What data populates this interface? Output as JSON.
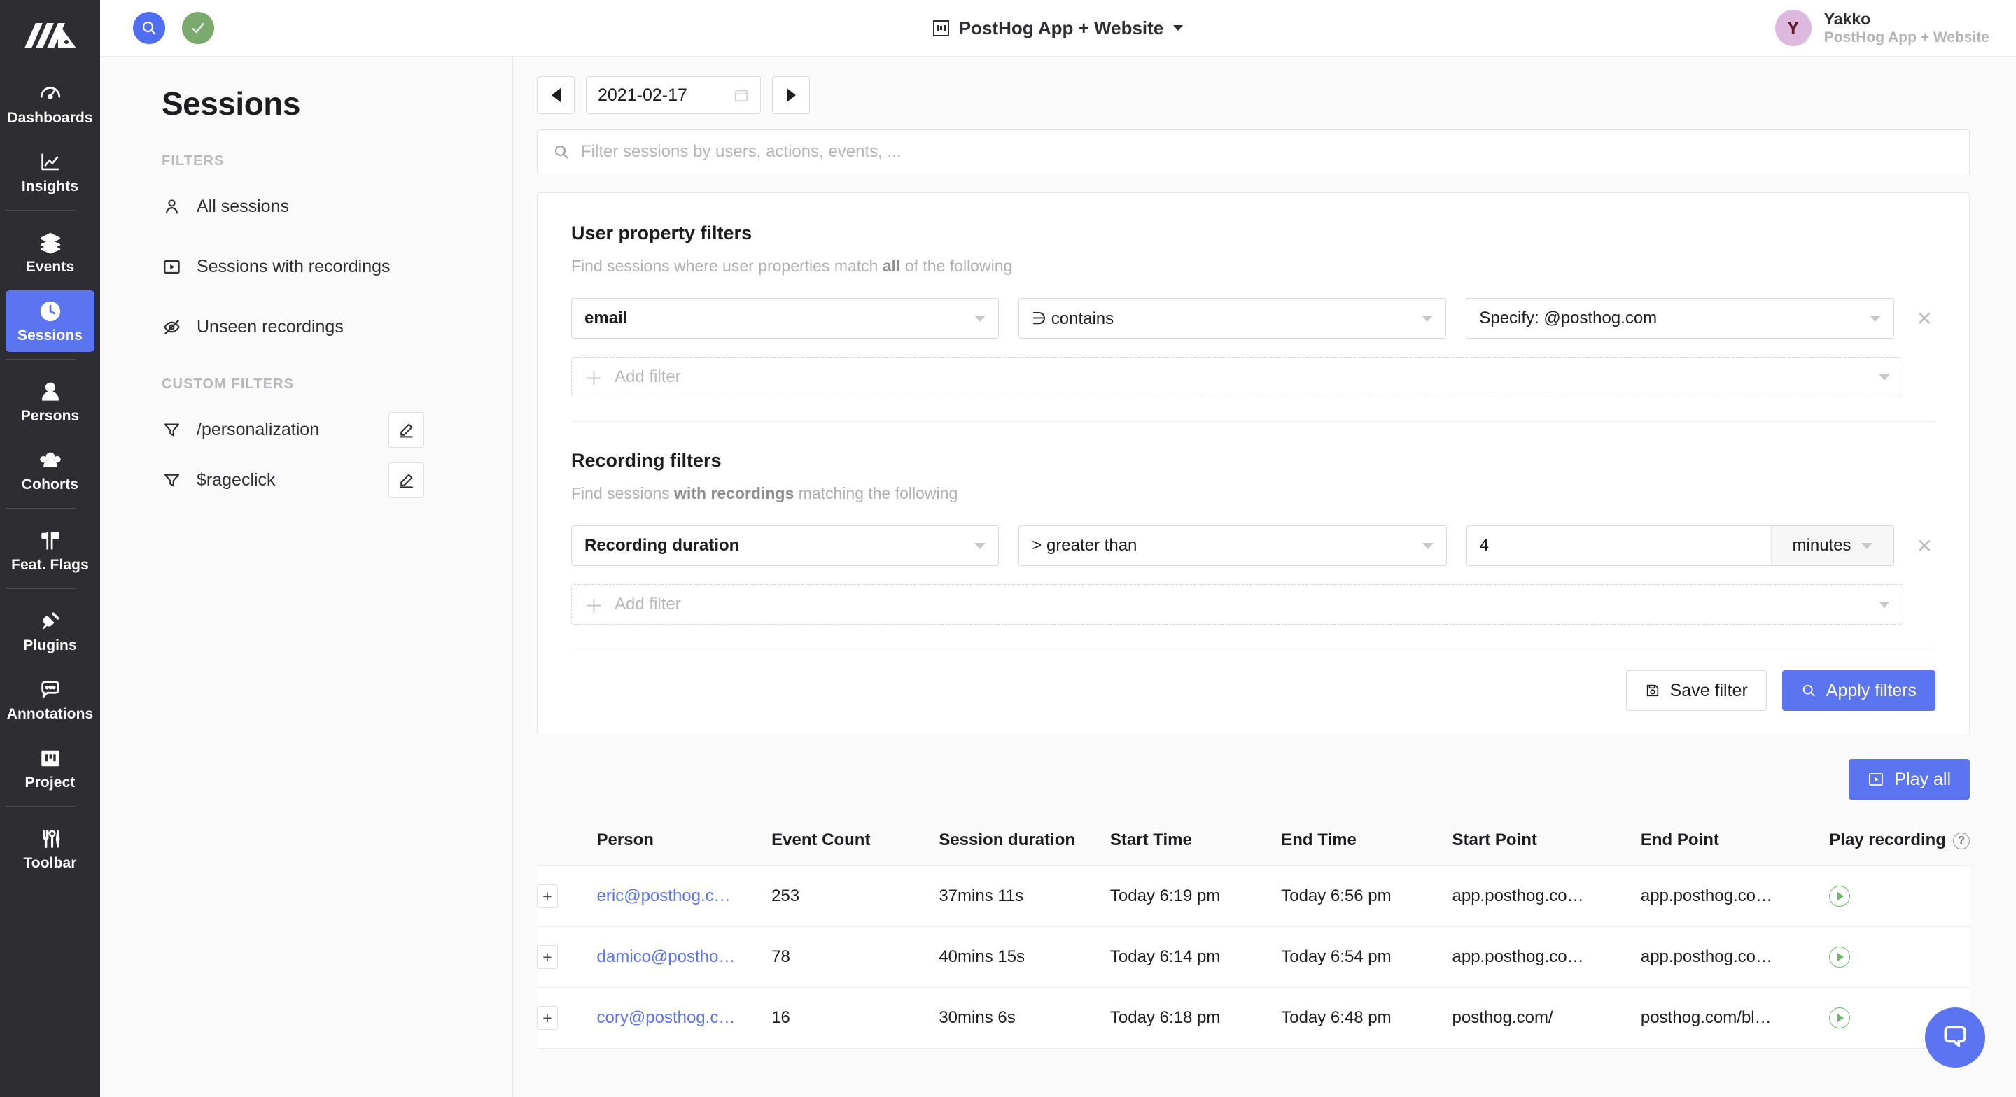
{
  "colors": {
    "accent": "#5b75f0",
    "nav_bg": "#2d2d32",
    "green": "#6cb86c",
    "avatar_bg": "#ddb9e0"
  },
  "topbar": {
    "search_icon": "search-icon",
    "check_icon": "check-icon",
    "project_icon": "project-icon",
    "title": "PostHog App + Website",
    "chevron_icon": "chevron-down-icon",
    "user": {
      "initial": "Y",
      "name": "Yakko",
      "org": "PostHog App + Website"
    }
  },
  "sidebar": {
    "logo": "posthog-logo",
    "items": [
      {
        "label": "Dashboards",
        "icon": "dashboards-icon",
        "active": false,
        "sep_after": false
      },
      {
        "label": "Insights",
        "icon": "insights-icon",
        "active": false,
        "sep_after": true
      },
      {
        "label": "Events",
        "icon": "events-icon",
        "active": false,
        "sep_after": false
      },
      {
        "label": "Sessions",
        "icon": "clock-icon",
        "active": true,
        "sep_after": true
      },
      {
        "label": "Persons",
        "icon": "person-icon",
        "active": false,
        "sep_after": false
      },
      {
        "label": "Cohorts",
        "icon": "cohorts-icon",
        "active": false,
        "sep_after": true
      },
      {
        "label": "Feat. Flags",
        "icon": "flag-icon",
        "active": false,
        "sep_after": true
      },
      {
        "label": "Plugins",
        "icon": "plug-icon",
        "active": false,
        "sep_after": false
      },
      {
        "label": "Annotations",
        "icon": "comment-dots-icon",
        "active": false,
        "sep_after": false
      },
      {
        "label": "Project",
        "icon": "project-icon",
        "active": false,
        "sep_after": true
      },
      {
        "label": "Toolbar",
        "icon": "toolbar-icon",
        "active": false,
        "sep_after": false
      }
    ]
  },
  "leftpanel": {
    "page_title": "Sessions",
    "filters_label": "FILTERS",
    "filters": [
      {
        "label": "All sessions",
        "icon": "person-outline-icon"
      },
      {
        "label": "Sessions with recordings",
        "icon": "play-box-icon"
      },
      {
        "label": "Unseen recordings",
        "icon": "eye-off-icon"
      }
    ],
    "custom_label": "CUSTOM FILTERS",
    "custom_filters": [
      {
        "label": "/personalization",
        "icon": "funnel-icon",
        "edit_icon": "pencil-icon"
      },
      {
        "label": "$rageclick",
        "icon": "funnel-icon",
        "edit_icon": "pencil-icon"
      }
    ]
  },
  "main": {
    "date": {
      "prev_icon": "arrow-left-icon",
      "value": "2021-02-17",
      "calendar_icon": "calendar-icon",
      "next_icon": "arrow-right-icon"
    },
    "search": {
      "icon": "search-icon",
      "placeholder": "Filter sessions by users, actions, events, ..."
    },
    "user_property_filters": {
      "title": "User property filters",
      "desc_pre": "Find sessions where user properties match ",
      "desc_bold": "all",
      "desc_post": " of the following",
      "rows": [
        {
          "property": "email",
          "operator": "∋ contains",
          "value": "Specify: @posthog.com",
          "remove_icon": "close-icon"
        }
      ],
      "add_filter": "Add filter"
    },
    "recording_filters": {
      "title": "Recording filters",
      "desc_pre": "Find sessions ",
      "desc_bold": "with recordings",
      "desc_post": " matching the following",
      "rows": [
        {
          "property": "Recording duration",
          "operator": "> greater than",
          "value": "4",
          "unit": "minutes",
          "remove_icon": "close-icon"
        }
      ],
      "add_filter": "Add filter"
    },
    "save_filter": {
      "label": "Save filter",
      "icon": "save-icon"
    },
    "apply_filters": {
      "label": "Apply filters",
      "icon": "search-icon"
    },
    "play_all": {
      "label": "Play all",
      "icon": "play-box-icon"
    },
    "table": {
      "columns": [
        "Person",
        "Event Count",
        "Session duration",
        "Start Time",
        "End Time",
        "Start Point",
        "End Point",
        "Play recording"
      ],
      "help_icon": "question-circle-icon",
      "expand_icon": "plus-icon",
      "play_icon": "play-circle-icon",
      "rows": [
        {
          "person": "eric@posthog.c…",
          "event_count": "253",
          "duration": "37mins 11s",
          "start_time": "Today 6:19 pm",
          "end_time": "Today 6:56 pm",
          "start_point": "app.posthog.co…",
          "end_point": "app.posthog.co…"
        },
        {
          "person": "damico@postho…",
          "event_count": "78",
          "duration": "40mins 15s",
          "start_time": "Today 6:14 pm",
          "end_time": "Today 6:54 pm",
          "start_point": "app.posthog.co…",
          "end_point": "app.posthog.co…"
        },
        {
          "person": "cory@posthog.c…",
          "event_count": "16",
          "duration": "30mins 6s",
          "start_time": "Today 6:18 pm",
          "end_time": "Today 6:48 pm",
          "start_point": "posthog.com/",
          "end_point": "posthog.com/bl…"
        }
      ]
    }
  },
  "chat": {
    "icon": "chat-bubble-icon"
  }
}
